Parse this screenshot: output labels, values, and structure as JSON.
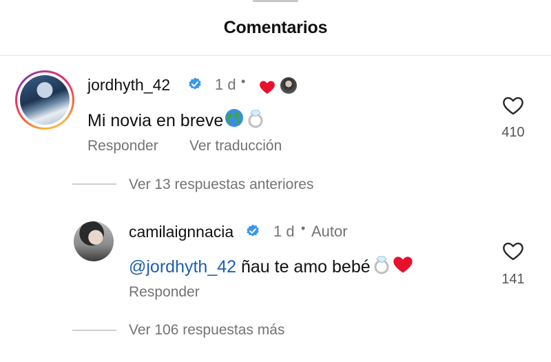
{
  "header": {
    "title": "Comentarios"
  },
  "comments": [
    {
      "username": "jordhyth_42",
      "time": "1 d",
      "text": "Mi novia en breve",
      "reply_label": "Responder",
      "translate_label": "Ver traducción",
      "likes": "410"
    }
  ],
  "thread": {
    "view_previous": "Ver 13 respuestas anteriores"
  },
  "replies": [
    {
      "username": "camilaignnacia",
      "time": "1 d",
      "badge": "Autor",
      "mention": "@jordhyth_42",
      "text": "ñau te amo bebé",
      "reply_label": "Responder",
      "likes": "141"
    }
  ],
  "footer": {
    "view_more": "Ver 106 respuestas más"
  },
  "colors": {
    "verified": "#3897f0",
    "mention": "#1c5fb4",
    "muted": "#737373",
    "heart_red": "#e8112d"
  },
  "icons": [
    "verified-badge-icon",
    "red-heart-icon",
    "globe-emoji-icon",
    "ring-emoji-icon",
    "heart-outline-icon"
  ]
}
